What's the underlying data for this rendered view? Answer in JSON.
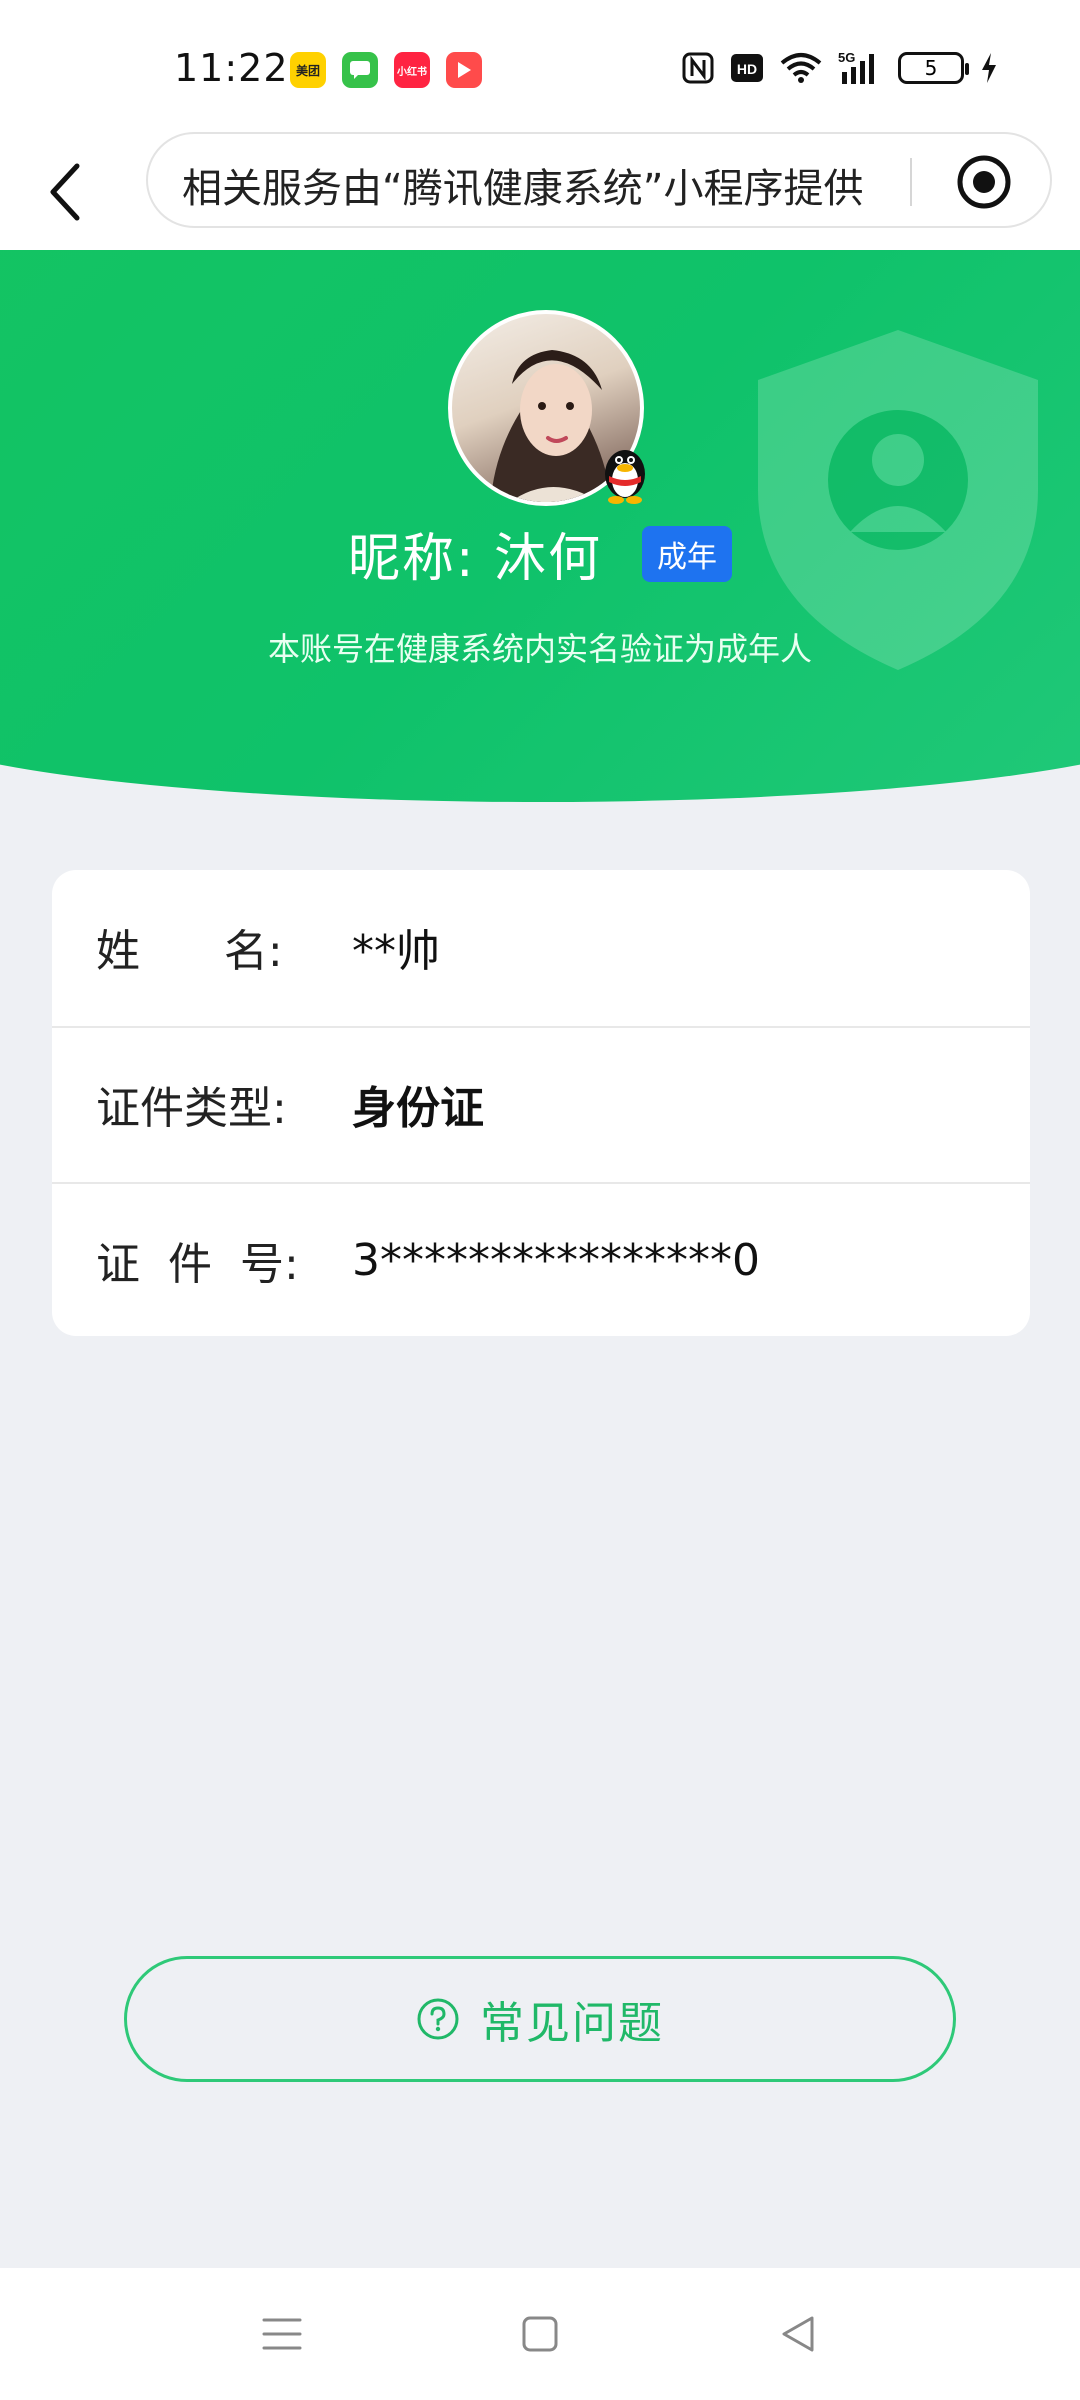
{
  "status_bar": {
    "time": "11:22",
    "apps": [
      {
        "label": "美团",
        "color": "#ffd100",
        "text_color": "#222"
      },
      {
        "label": "",
        "color": "#36c24a",
        "icon": "message-icon"
      },
      {
        "label": "小红书",
        "color": "#ff2442",
        "text_color": "#fff"
      },
      {
        "label": "",
        "color": "#ff4b4b",
        "icon": "play-icon"
      }
    ],
    "network": "5G",
    "hd_label": "HD",
    "battery": "5"
  },
  "nav": {
    "title": "相关服务由“腾讯健康系统”小程序提供"
  },
  "profile": {
    "nickname": "昵称:  沐何",
    "age_badge": "成年",
    "verify_note": "本账号在健康系统内实名验证为成年人"
  },
  "info": {
    "rows": [
      {
        "label": "姓      名:",
        "value": "**帅"
      },
      {
        "label": "证件类型:",
        "value": "身份证"
      },
      {
        "label": "证  件  号:",
        "value": "3****************0"
      }
    ]
  },
  "faq": {
    "label": "常见问题"
  },
  "colors": {
    "primary_green": "#15c460",
    "accent_blue": "#1e73f0",
    "faq_green": "#20b868"
  }
}
